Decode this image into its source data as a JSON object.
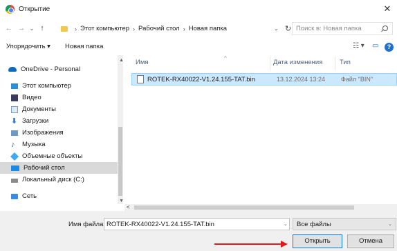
{
  "window": {
    "title": "Открытие",
    "close_glyph": "✕"
  },
  "nav": {
    "back": "←",
    "forward": "→",
    "recent": "⌄",
    "up": "↑",
    "refresh": "↻",
    "sep": "›"
  },
  "breadcrumbs": [
    "Этот компьютер",
    "Рабочий стол",
    "Новая папка"
  ],
  "search": {
    "placeholder": "Поиск в: Новая папка"
  },
  "toolbar": {
    "organize": "Упорядочить ▾",
    "new_folder": "Новая папка",
    "view_glyph": "☷ ▾",
    "pane_glyph": "▭",
    "help": "?"
  },
  "sidebar": {
    "items": [
      {
        "label": "OneDrive - Personal",
        "icon": "cloud-icon",
        "color": "#0f6cbd"
      },
      {
        "label": "Этот компьютер",
        "icon": "computer-icon",
        "color": "#2b8fd6"
      },
      {
        "label": "Видео",
        "icon": "video-icon",
        "color": "#3a3a5c"
      },
      {
        "label": "Документы",
        "icon": "documents-icon",
        "color": "#7e9fbf"
      },
      {
        "label": "Загрузки",
        "icon": "downloads-icon",
        "color": "#2d7fd8"
      },
      {
        "label": "Изображения",
        "icon": "pictures-icon",
        "color": "#6b9ac4"
      },
      {
        "label": "Музыка",
        "icon": "music-icon",
        "color": "#2f5fa8"
      },
      {
        "label": "Объемные объекты",
        "icon": "3d-objects-icon",
        "color": "#3fa9f5"
      },
      {
        "label": "Рабочий стол",
        "icon": "desktop-icon",
        "color": "#1e88e5"
      },
      {
        "label": "Локальный диск (C:)",
        "icon": "drive-icon",
        "color": "#8a8a8a"
      },
      {
        "label": "Сеть",
        "icon": "network-icon",
        "color": "#3b8be0"
      }
    ],
    "selected": "Рабочий стол"
  },
  "columns": {
    "name": "Имя",
    "date": "Дата изменения",
    "type": "Тип"
  },
  "files": [
    {
      "name": "ROTEK-RX40022-V1.24.155-TAT.bin",
      "date": "13.12.2024 13:24",
      "type": "Файл \"BIN\""
    }
  ],
  "bottom": {
    "filename_label": "Имя файла:",
    "filename_value": "ROTEK-RX40022-V1.24.155-TAT.bin",
    "filetype": "Все файлы",
    "open_label": "Открыть",
    "cancel_label": "Отмена"
  },
  "colors": {
    "accent": "#0078d7",
    "selection": "#cce8ff",
    "annotation_arrow": "#e0191d"
  }
}
